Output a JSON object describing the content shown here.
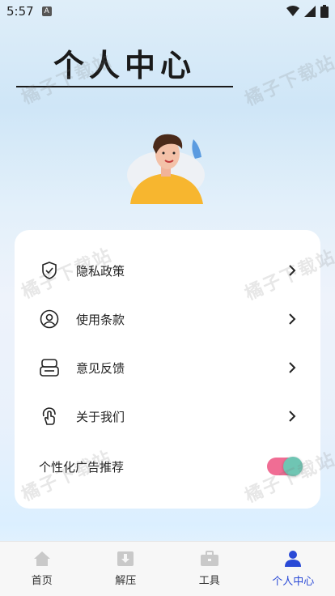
{
  "status_bar": {
    "time": "5:57",
    "sim_label": "A"
  },
  "header": {
    "title": "个人中心"
  },
  "menu": {
    "items": [
      {
        "label": "隐私政策",
        "icon": "shield-check-icon"
      },
      {
        "label": "使用条款",
        "icon": "user-circle-icon"
      },
      {
        "label": "意见反馈",
        "icon": "feedback-icon"
      },
      {
        "label": "关于我们",
        "icon": "tap-hand-icon"
      }
    ],
    "toggle": {
      "label": "个性化广告推荐",
      "enabled": true
    }
  },
  "watermark": "橘子下载站",
  "tabbar": {
    "tabs": [
      {
        "label": "首页",
        "icon": "home-icon",
        "active": false
      },
      {
        "label": "解压",
        "icon": "archive-icon",
        "active": false
      },
      {
        "label": "工具",
        "icon": "toolbox-icon",
        "active": false
      },
      {
        "label": "个人中心",
        "icon": "person-icon",
        "active": true
      }
    ]
  },
  "colors": {
    "accent": "#2a4ad6",
    "toggle_track": "#f06d94",
    "toggle_knob": "#6fc5b3"
  }
}
